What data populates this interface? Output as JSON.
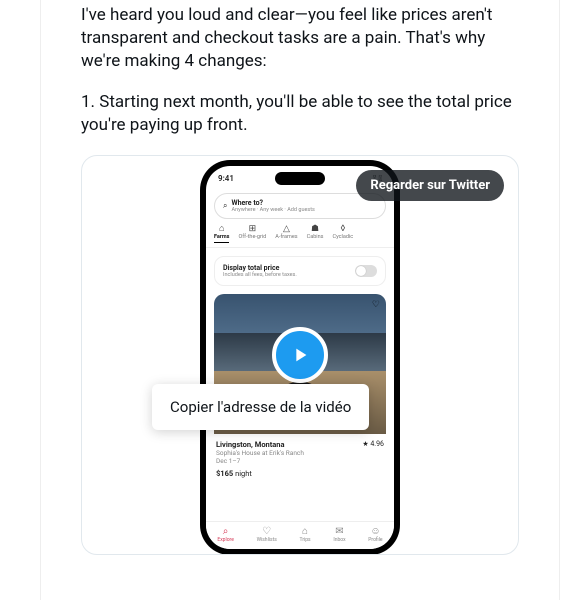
{
  "tweet": {
    "p1": "I've heard you loud and clear—you feel like prices aren't transparent and checkout tasks are a pain. That's why we're making 4 changes:",
    "p2": "1. Starting next month, you'll be able to see the total price you're paying up front."
  },
  "media": {
    "watch_label": "Regarder sur Twitter",
    "context_menu_item": "Copier l'adresse de la vidéo"
  },
  "phone": {
    "time": "9:41",
    "search": {
      "title": "Where to?",
      "subtitle": "Anywhere · Any week · Add guests"
    },
    "categories": [
      {
        "icon": "⌂",
        "label": "Farms",
        "active": true
      },
      {
        "icon": "⊞",
        "label": "Off-the-grid"
      },
      {
        "icon": "△",
        "label": "A-frames"
      },
      {
        "icon": "☗",
        "label": "Cabins"
      },
      {
        "icon": "◊",
        "label": "Cycladic"
      }
    ],
    "toggle": {
      "title": "Display total price",
      "subtitle": "Includes all fees, before taxes."
    },
    "listing": {
      "location": "Livingston, Montana",
      "rating": "★ 4.96",
      "host": "Sophia's House at Erik's Ranch",
      "dates": "Dec 1–7",
      "price_amount": "$165",
      "price_unit": " night"
    },
    "nav": [
      {
        "icon": "⌕",
        "label": "Explore",
        "active": true
      },
      {
        "icon": "♡",
        "label": "Wishlists"
      },
      {
        "icon": "⌂",
        "label": "Trips"
      },
      {
        "icon": "✉",
        "label": "Inbox"
      },
      {
        "icon": "☺",
        "label": "Profile"
      }
    ]
  }
}
